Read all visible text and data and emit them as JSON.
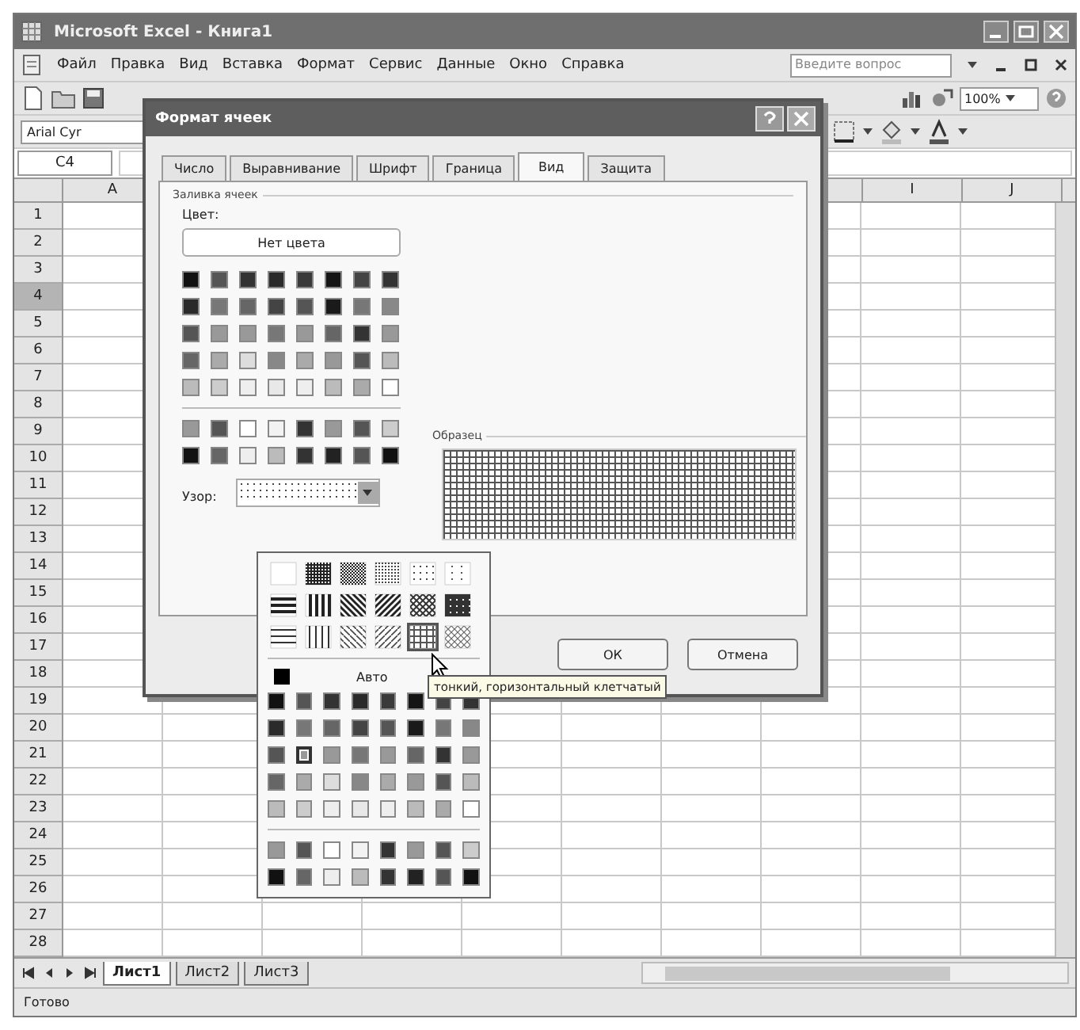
{
  "window": {
    "title": "Microsoft Excel - Книга1"
  },
  "menu": [
    {
      "label": "Файл"
    },
    {
      "label": "Правка"
    },
    {
      "label": "Вид"
    },
    {
      "label": "Вставка"
    },
    {
      "label": "Формат"
    },
    {
      "label": "Сервис"
    },
    {
      "label": "Данные"
    },
    {
      "label": "Окно"
    },
    {
      "label": "Справка"
    }
  ],
  "help_search": {
    "placeholder": "Введите вопрос"
  },
  "toolbar": {
    "zoom": "100%"
  },
  "formatting": {
    "font": "Arial Cyr"
  },
  "name_box": "C4",
  "columns": [
    "A",
    "I",
    "J"
  ],
  "rows": [
    {
      "label": "1",
      "selected": false
    },
    {
      "label": "2",
      "selected": false
    },
    {
      "label": "3",
      "selected": false
    },
    {
      "label": "4",
      "selected": true
    },
    {
      "label": "5",
      "selected": false
    },
    {
      "label": "6",
      "selected": false
    },
    {
      "label": "7",
      "selected": false
    },
    {
      "label": "8",
      "selected": false
    },
    {
      "label": "9",
      "selected": false
    },
    {
      "label": "10",
      "selected": false
    },
    {
      "label": "11",
      "selected": false
    },
    {
      "label": "12",
      "selected": false
    },
    {
      "label": "13",
      "selected": false
    },
    {
      "label": "14",
      "selected": false
    },
    {
      "label": "15",
      "selected": false
    },
    {
      "label": "16",
      "selected": false
    },
    {
      "label": "17",
      "selected": false
    },
    {
      "label": "18",
      "selected": false
    },
    {
      "label": "19",
      "selected": false
    },
    {
      "label": "20",
      "selected": false
    },
    {
      "label": "21",
      "selected": false
    },
    {
      "label": "22",
      "selected": false
    },
    {
      "label": "23",
      "selected": false
    },
    {
      "label": "24",
      "selected": false
    },
    {
      "label": "25",
      "selected": false
    },
    {
      "label": "26",
      "selected": false
    },
    {
      "label": "27",
      "selected": false
    },
    {
      "label": "28",
      "selected": false
    }
  ],
  "sheet_tabs": [
    {
      "label": "Лист1",
      "selected": true
    },
    {
      "label": "Лист2",
      "selected": false
    },
    {
      "label": "Лист3",
      "selected": false
    }
  ],
  "status_bar": "Готово",
  "dialog": {
    "title": "Формат ячеек",
    "tabs": [
      {
        "label": "Число",
        "selected": false
      },
      {
        "label": "Выравнивание",
        "selected": false
      },
      {
        "label": "Шрифт",
        "selected": false
      },
      {
        "label": "Граница",
        "selected": false
      },
      {
        "label": "Вид",
        "selected": true
      },
      {
        "label": "Защита",
        "selected": false
      }
    ],
    "group": "Заливка ячеек",
    "color_label": "Цвет:",
    "no_color_button": "Нет цвета",
    "palette_rows": [
      {
        "swatches": [
          {
            "color": "#111111"
          },
          {
            "color": "#555555"
          },
          {
            "color": "#333333"
          },
          {
            "color": "#2a2a2a"
          },
          {
            "color": "#3a3a3a"
          },
          {
            "color": "#151515"
          },
          {
            "color": "#444444"
          },
          {
            "color": "#333333"
          }
        ]
      },
      {
        "swatches": [
          {
            "color": "#2a2a2a"
          },
          {
            "color": "#777777"
          },
          {
            "color": "#666666"
          },
          {
            "color": "#444444"
          },
          {
            "color": "#555555"
          },
          {
            "color": "#1a1a1a"
          },
          {
            "color": "#777777"
          },
          {
            "color": "#888888"
          }
        ]
      },
      {
        "swatches": [
          {
            "color": "#555555"
          },
          {
            "color": "#999999"
          },
          {
            "color": "#999999"
          },
          {
            "color": "#777777"
          },
          {
            "color": "#999999"
          },
          {
            "color": "#666666"
          },
          {
            "color": "#333333"
          },
          {
            "color": "#999999"
          }
        ]
      },
      {
        "swatches": [
          {
            "color": "#666666"
          },
          {
            "color": "#aaaaaa"
          },
          {
            "color": "#dddddd"
          },
          {
            "color": "#888888"
          },
          {
            "color": "#aaaaaa"
          },
          {
            "color": "#999999"
          },
          {
            "color": "#555555"
          },
          {
            "color": "#bbbbbb"
          }
        ]
      },
      {
        "swatches": [
          {
            "color": "#bbbbbb"
          },
          {
            "color": "#cccccc"
          },
          {
            "color": "#eeeeee"
          },
          {
            "color": "#e8e8e8"
          },
          {
            "color": "#eeeeee"
          },
          {
            "color": "#bbbbbb"
          },
          {
            "color": "#aaaaaa"
          },
          {
            "color": "#ffffff"
          }
        ]
      }
    ],
    "extra_rows": [
      {
        "swatches": [
          {
            "color": "#999999"
          },
          {
            "color": "#555555"
          },
          {
            "color": "#ffffff"
          },
          {
            "color": "#f2f2f2"
          },
          {
            "color": "#333333"
          },
          {
            "color": "#999999"
          },
          {
            "color": "#555555"
          },
          {
            "color": "#cccccc"
          }
        ]
      },
      {
        "swatches": [
          {
            "color": "#111111"
          },
          {
            "color": "#666666"
          },
          {
            "color": "#eeeeee"
          },
          {
            "color": "#bbbbbb"
          },
          {
            "color": "#333333"
          },
          {
            "color": "#222222"
          },
          {
            "color": "#555555"
          },
          {
            "color": "#111111"
          }
        ]
      }
    ],
    "sample_label": "Образец",
    "pattern_label": "Узор:",
    "buttons": [
      "ОК",
      "Отмена"
    ]
  },
  "pattern_menu": {
    "patterns": [
      {
        "kind": "solid",
        "selected": false
      },
      {
        "kind": "dark",
        "selected": false
      },
      {
        "kind": "gray50",
        "selected": false
      },
      {
        "kind": "gray25",
        "selected": false
      },
      {
        "kind": "gray12",
        "selected": false
      },
      {
        "kind": "gray6",
        "selected": false
      },
      {
        "kind": "hstripe",
        "selected": false
      },
      {
        "kind": "vstripe",
        "selected": false
      },
      {
        "kind": "rdiag",
        "selected": false
      },
      {
        "kind": "ldiag",
        "selected": false
      },
      {
        "kind": "dcross",
        "selected": false
      },
      {
        "kind": "thickcross",
        "selected": false
      },
      {
        "kind": "thinh",
        "selected": false
      },
      {
        "kind": "thinv",
        "selected": false
      },
      {
        "kind": "thinrdiag",
        "selected": false
      },
      {
        "kind": "thinldiag",
        "selected": false
      },
      {
        "kind": "thincross",
        "selected": true
      },
      {
        "kind": "thindcross",
        "selected": false
      }
    ],
    "auto_label": "Авто",
    "palette_rows": [
      {
        "swatches": [
          {
            "color": "#111111",
            "selected": false
          },
          {
            "color": "#555555",
            "selected": false
          },
          {
            "color": "#333333",
            "selected": false
          },
          {
            "color": "#2a2a2a",
            "selected": false
          },
          {
            "color": "#3a3a3a",
            "selected": false
          },
          {
            "color": "#151515",
            "selected": false
          },
          {
            "color": "#444444",
            "selected": false
          },
          {
            "color": "#333333",
            "selected": false
          }
        ]
      },
      {
        "swatches": [
          {
            "color": "#2a2a2a",
            "selected": false
          },
          {
            "color": "#777777",
            "selected": false
          },
          {
            "color": "#666666",
            "selected": false
          },
          {
            "color": "#444444",
            "selected": false
          },
          {
            "color": "#555555",
            "selected": false
          },
          {
            "color": "#1a1a1a",
            "selected": false
          },
          {
            "color": "#777777",
            "selected": false
          },
          {
            "color": "#888888",
            "selected": false
          }
        ]
      },
      {
        "swatches": [
          {
            "color": "#555555",
            "selected": false
          },
          {
            "color": "#999999",
            "selected": true
          },
          {
            "color": "#999999",
            "selected": false
          },
          {
            "color": "#777777",
            "selected": false
          },
          {
            "color": "#999999",
            "selected": false
          },
          {
            "color": "#666666",
            "selected": false
          },
          {
            "color": "#333333",
            "selected": false
          },
          {
            "color": "#999999",
            "selected": false
          }
        ]
      },
      {
        "swatches": [
          {
            "color": "#666666",
            "selected": false
          },
          {
            "color": "#aaaaaa",
            "selected": false
          },
          {
            "color": "#dddddd",
            "selected": false
          },
          {
            "color": "#888888",
            "selected": false
          },
          {
            "color": "#aaaaaa",
            "selected": false
          },
          {
            "color": "#999999",
            "selected": false
          },
          {
            "color": "#555555",
            "selected": false
          },
          {
            "color": "#bbbbbb",
            "selected": false
          }
        ]
      },
      {
        "swatches": [
          {
            "color": "#bbbbbb",
            "selected": false
          },
          {
            "color": "#cccccc",
            "selected": false
          },
          {
            "color": "#eeeeee",
            "selected": false
          },
          {
            "color": "#e8e8e8",
            "selected": false
          },
          {
            "color": "#eeeeee",
            "selected": false
          },
          {
            "color": "#bbbbbb",
            "selected": false
          },
          {
            "color": "#aaaaaa",
            "selected": false
          },
          {
            "color": "#ffffff",
            "selected": false
          }
        ]
      }
    ],
    "extra_rows": [
      {
        "swatches": [
          {
            "color": "#999999",
            "selected": false
          },
          {
            "color": "#555555",
            "selected": false
          },
          {
            "color": "#ffffff",
            "selected": false
          },
          {
            "color": "#f2f2f2",
            "selected": false
          },
          {
            "color": "#333333",
            "selected": false
          },
          {
            "color": "#999999",
            "selected": false
          },
          {
            "color": "#555555",
            "selected": false
          },
          {
            "color": "#cccccc",
            "selected": false
          }
        ]
      },
      {
        "swatches": [
          {
            "color": "#111111",
            "selected": false
          },
          {
            "color": "#666666",
            "selected": false
          },
          {
            "color": "#eeeeee",
            "selected": false
          },
          {
            "color": "#bbbbbb",
            "selected": false
          },
          {
            "color": "#333333",
            "selected": false
          },
          {
            "color": "#222222",
            "selected": false
          },
          {
            "color": "#555555",
            "selected": false
          },
          {
            "color": "#111111",
            "selected": false
          }
        ]
      }
    ]
  },
  "tooltip": "тонкий, горизонтальный клетчатый"
}
